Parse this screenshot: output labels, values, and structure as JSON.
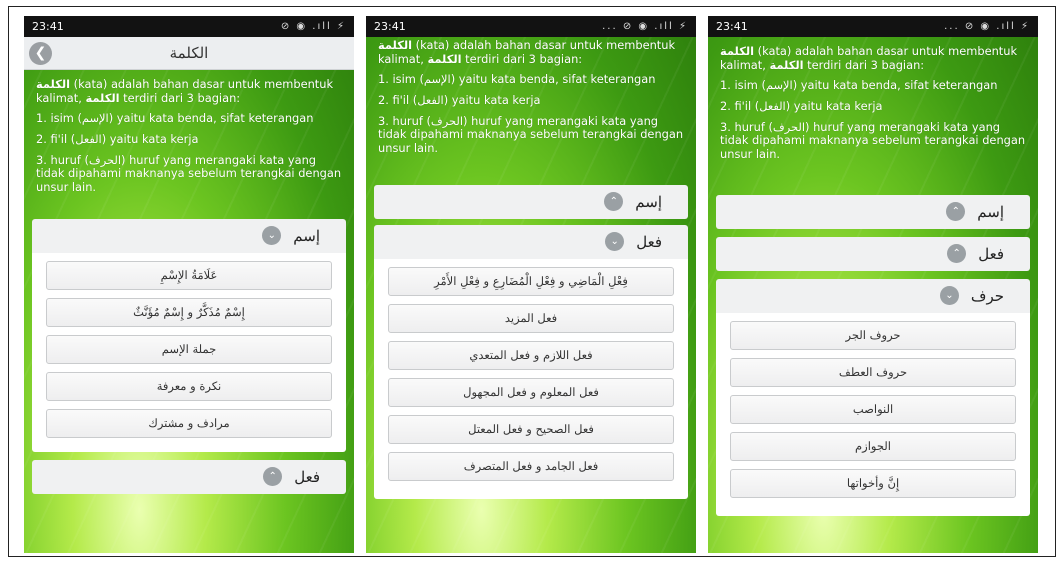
{
  "shared": {
    "p1_a": "الكلمة",
    "p1_b": " (kata) adalah bahan dasar untuk membentuk kalimat, ",
    "p1_c": "الكلمة",
    "p1_d": " terdiri dari 3 bagian:",
    "p2": "1. isim (الإسم) yaitu kata benda, sifat keterangan",
    "p3": "2. fi'il (الفعل) yaitu kata kerja",
    "p4": "3. huruf (الحرف) huruf yang merangaki kata yang tidak dipahami maknanya sebelum terangkai dengan unsur lain.",
    "sec_isim": "إسم",
    "sec_fiil": "فعل",
    "sec_harf": "حرف"
  },
  "screen1": {
    "time": "23:41",
    "status_icons": "⊘ ◉ .ıll ⚡",
    "title": "الكلمة",
    "items": [
      "عَلَامَةُ الإِسْمِ",
      "إِسْمٌ مُذَكَّرٌ و إِسْمٌ مُؤَنَّثٌ",
      "جملة الإسم",
      "نكرة و معرفة",
      "مرادف و مشترك"
    ]
  },
  "screen2": {
    "time": "23:41",
    "status_icons": "... ⊘ ◉ .ıll ⚡",
    "items": [
      "فِعْلِ الْمَاضِي و فِعْلِ الْمُضَارِعِ و فِعْلِ الأَمْرِ",
      "فعل المزيد",
      "فعل اللازم و فعل المتعدي",
      "فعل المعلوم و فعل المجهول",
      "فعل الصحيح و فعل المعتل",
      "فعل الجامد و فعل المتصرف"
    ]
  },
  "screen3": {
    "time": "23:41",
    "status_icons": "... ⊘ ◉ .ıll ⚡",
    "items": [
      "حروف الجر",
      "حروف العطف",
      "النواصب",
      "الجوازم",
      "إِنَّ وأخواتها"
    ]
  }
}
